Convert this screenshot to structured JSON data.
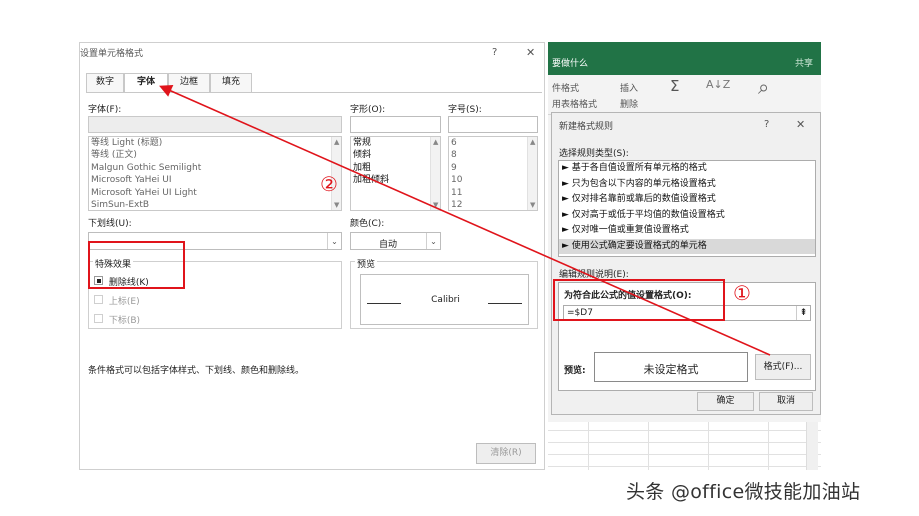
{
  "excel": {
    "tell_me": "要做什么",
    "share": "共享",
    "ribbon": {
      "cond_format": "件格式",
      "table_format": "用表格格式",
      "insert": "插入",
      "delete": "删除",
      "sort_filter": "排序和筛选",
      "find_select": "查找和选择"
    }
  },
  "format_cells": {
    "title": "设置单元格格式",
    "help": "?",
    "close": "✕",
    "tabs": [
      {
        "label": "数字"
      },
      {
        "label": "字体"
      },
      {
        "label": "边框"
      },
      {
        "label": "填充"
      }
    ],
    "font_label": "字体(F):",
    "font_items": [
      "等线 Light (标题)",
      "等线 (正文)",
      "Malgun Gothic Semilight",
      "Microsoft YaHei UI",
      "Microsoft YaHei UI Light",
      "SimSun-ExtB"
    ],
    "style_label": "字形(O):",
    "style_items": [
      "常规",
      "倾斜",
      "加粗",
      "加粗倾斜"
    ],
    "size_label": "字号(S):",
    "size_items": [
      "6",
      "8",
      "9",
      "10",
      "11",
      "12"
    ],
    "underline_label": "下划线(U):",
    "color_label": "颜色(C):",
    "color_value": "自动",
    "effects_label": "特殊效果",
    "strikethrough_label": "删除线(K)",
    "superscript_label": "上标(E)",
    "subscript_label": "下标(B)",
    "preview_label": "预览",
    "preview_text": "Calibri",
    "hint": "条件格式可以包括字体样式、下划线、颜色和删除线。",
    "clear_button": "清除(R)"
  },
  "new_rule": {
    "title": "新建格式规则",
    "help": "?",
    "close": "✕",
    "select_type_label": "选择规则类型(S):",
    "rule_types": [
      "► 基于各自值设置所有单元格的格式",
      "► 只为包含以下内容的单元格设置格式",
      "► 仅对排名靠前或靠后的数值设置格式",
      "► 仅对高于或低于平均值的数值设置格式",
      "► 仅对唯一值或重复值设置格式",
      "► 使用公式确定要设置格式的单元格"
    ],
    "edit_desc_label": "编辑规则说明(E):",
    "formula_label": "为符合此公式的值设置格式(O):",
    "formula_value": "=$D7",
    "preview_label": "预览:",
    "preview_text": "未设定格式",
    "format_button": "格式(F)...",
    "ok_button": "确定",
    "cancel_button": "取消"
  },
  "annotations": {
    "marker_1": "①",
    "marker_2": "②",
    "color": "#e0141b"
  },
  "watermark": "头条 @office微技能加油站"
}
